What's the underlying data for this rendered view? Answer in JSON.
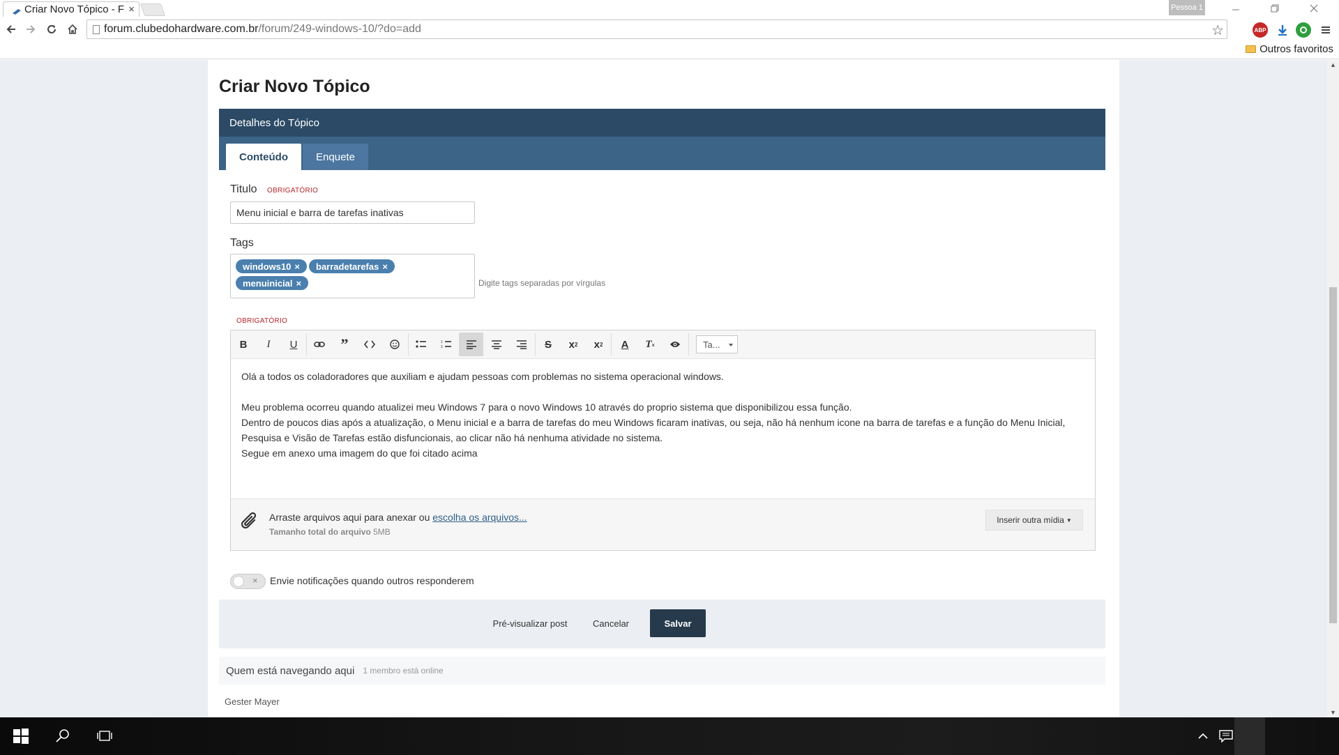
{
  "browser": {
    "tab_title": "Criar Novo Tópico - F",
    "tab_close": "×",
    "profile_label": "Pessoa 1",
    "url_host": "forum.clubedohardware.com.br",
    "url_path": "/forum/249-windows-10/?do=add",
    "bookmark_folder": "Outros favoritos",
    "abp_badge": "ABP"
  },
  "page": {
    "title": "Criar Novo Tópico",
    "section_header": "Detalhes do Tópico",
    "tabs": [
      {
        "label": "Conteúdo",
        "active": true
      },
      {
        "label": "Enquete",
        "active": false
      }
    ]
  },
  "form": {
    "title_label": "Titulo",
    "required_label": "OBRIGATÓRIO",
    "title_value": "Menu inicial e barra de tarefas inativas",
    "tags_label": "Tags",
    "tags": [
      "windows10",
      "barradetarefas",
      "menuinicial"
    ],
    "tag_remove": "×",
    "tags_hint": "Digite tags separadas por vírgulas",
    "content_required_label": "OBRIGATÓRIO",
    "size_select": "Ta...",
    "content_paragraphs": [
      "Olá a todos os coladoradores que auxiliam e ajudam pessoas com problemas no sistema operacional windows.",
      "",
      "Meu problema ocorreu quando atualizei meu Windows 7 para o novo Windows 10 através do proprio sistema que disponibilizou essa função.",
      "Dentro de poucos dias após a atualização, o Menu inicial e a barra de tarefas do meu Windows ficaram inativas, ou seja, não há nenhum icone na barra de tarefas e a função do Menu Inicial, Pesquisa e Visão de Tarefas estão disfuncionais, ao clicar não há nenhuma atividade no sistema.",
      "Segue em anexo uma imagem do que foi citado acima"
    ],
    "attach_text": "Arraste arquivos aqui para anexar ou",
    "attach_link": "escolha os arquivos...",
    "attach_size_label": "Tamanho total do arquivo",
    "attach_size_value": "5MB",
    "media_button": "Inserir outra mídia",
    "toggle_symbol": "×",
    "notify_label": "Envie notificações quando outros responderem",
    "preview_button": "Pré-visualizar post",
    "cancel_button": "Cancelar",
    "save_button": "Salvar"
  },
  "online": {
    "heading": "Quem está navegando aqui",
    "count": "1 membro está online",
    "members": [
      "Gester Mayer"
    ]
  },
  "colors": {
    "section_header": "#2c4a66",
    "tabs_bar": "#3b6487",
    "tag": "#4a7fae",
    "save_button": "#263a4c",
    "required": "#b5242a",
    "page_bg": "#ebeef2"
  }
}
